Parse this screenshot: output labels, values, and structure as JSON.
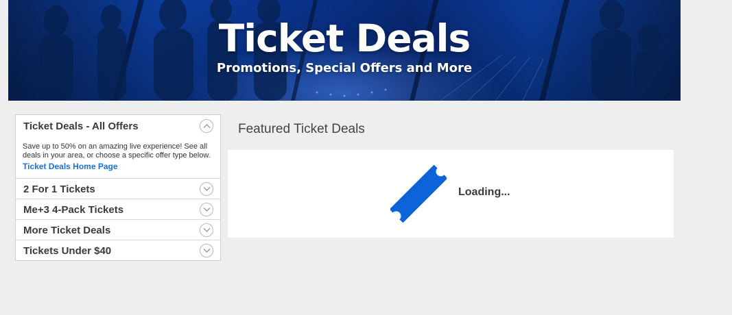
{
  "banner": {
    "title": "Ticket Deals",
    "subtitle": "Promotions, Special Offers and More"
  },
  "sidebar": {
    "sections": [
      {
        "label": "Ticket Deals - All Offers",
        "expanded": true,
        "description": "Save up to 50% on an amazing live experience! See all deals in your area, or choose a specific offer type below.",
        "link": "Ticket Deals Home Page"
      },
      {
        "label": "2 For 1 Tickets",
        "expanded": false
      },
      {
        "label": "Me+3 4-Pack Tickets",
        "expanded": false
      },
      {
        "label": "More Ticket Deals",
        "expanded": false
      },
      {
        "label": "Tickets Under $40",
        "expanded": false
      }
    ]
  },
  "main": {
    "title": "Featured Ticket Deals",
    "loading_text": "Loading..."
  },
  "colors": {
    "page_bg": "#eeeeee",
    "accent_blue": "#0d64d8",
    "link_blue": "#1e6fd9",
    "banner_blue": "#0d47b8"
  },
  "icons": {
    "chevron_up": "chevron-up-icon",
    "chevron_down": "chevron-down-icon",
    "ticket": "ticket-icon"
  }
}
